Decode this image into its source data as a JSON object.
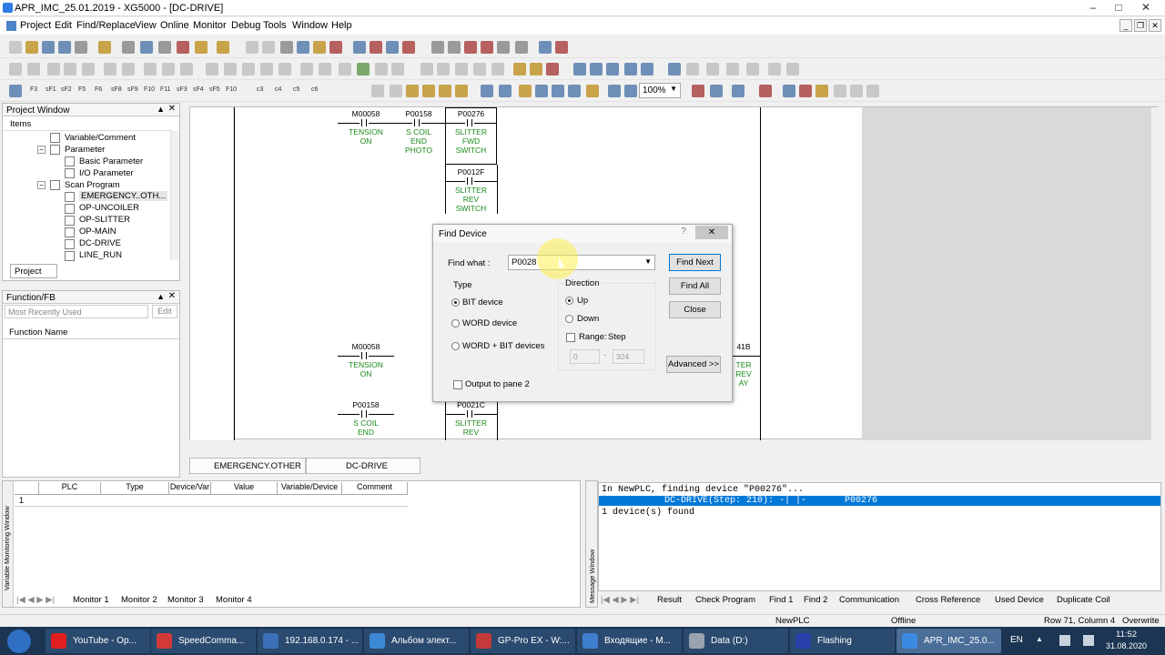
{
  "window": {
    "title": "APR_IMC_25.01.2019 - XG5000 - [DC-DRIVE]"
  },
  "menu": [
    "Project",
    "Edit",
    "Find/Replace",
    "View",
    "Online",
    "Monitor",
    "Debug",
    "Tools",
    "Window",
    "Help"
  ],
  "toolbar": {
    "zoom": "100%",
    "fkeys": [
      "F3",
      "sF1",
      "sF2",
      "F5",
      "F6",
      "sF8",
      "sF9",
      "F10",
      "F11",
      "sF3",
      "sF4",
      "sF5",
      "F10",
      "c3",
      "c4",
      "c5",
      "c6"
    ]
  },
  "project_window": {
    "title": "Project Window",
    "header": "Items",
    "items": [
      {
        "label": "Variable/Comment"
      },
      {
        "label": "Parameter"
      },
      {
        "label": "Basic Parameter"
      },
      {
        "label": "I/O Parameter"
      },
      {
        "label": "Scan Program"
      },
      {
        "label": "EMERGENCY..OTH..."
      },
      {
        "label": "OP-UNCOILER"
      },
      {
        "label": "OP-SLITTER"
      },
      {
        "label": "OP-MAIN"
      },
      {
        "label": "DC-DRIVE"
      },
      {
        "label": "LINE_RUN"
      }
    ],
    "tab": "Project"
  },
  "function_fb": {
    "title": "Function/FB",
    "recent": "Most Recently Used",
    "edit": "Edit",
    "column": "Function Name"
  },
  "ladder": {
    "top": [
      {
        "dev": "M00058",
        "cmt": [
          "TENSION",
          "ON"
        ]
      },
      {
        "dev": "P00158",
        "cmt": [
          "S COIL",
          "END",
          "PHOTO"
        ]
      },
      {
        "dev": "P00276",
        "cmt": [
          "SLITTER",
          "FWD",
          "SWITCH"
        ]
      },
      {
        "dev": "P0012F",
        "cmt": [
          "SLITTER",
          "REV",
          "SWITCH"
        ]
      }
    ],
    "bottom": [
      {
        "dev": "M00058",
        "cmt": [
          "TENSION",
          "ON"
        ]
      },
      {
        "dev": "P00158",
        "cmt": [
          "S COIL",
          "END"
        ]
      },
      {
        "dev": "P0021C",
        "cmt": [
          "SLITTER",
          "REV"
        ]
      },
      {
        "dev": "41B",
        "cmt": [
          "TER",
          "REV",
          "AY"
        ]
      }
    ]
  },
  "find_dialog": {
    "title": "Find Device",
    "find_what_label": "Find what :",
    "find_what_value": "P0028",
    "find_next": "Find Next",
    "find_all": "Find All",
    "close": "Close",
    "advanced": "Advanced >>",
    "type_label": "Type",
    "types": [
      "BIT device",
      "WORD device",
      "WORD + BIT devices"
    ],
    "direction_label": "Direction",
    "up": "Up",
    "down": "Down",
    "range_label": "Range:",
    "step_label": "Step",
    "range_from": "0",
    "range_to": "324",
    "output_pane2": "Output to pane 2"
  },
  "doc_tabs": [
    "EMERGENCY.OTHER",
    "DC-DRIVE"
  ],
  "var_monitor": {
    "side_label": "Variable Monitoring Window",
    "columns": [
      "PLC",
      "Type",
      "Device/Var",
      "Value",
      "Variable/Device",
      "Comment"
    ],
    "row1": "1",
    "tabs": [
      "Monitor 1",
      "Monitor 2",
      "Monitor 3",
      "Monitor 4"
    ]
  },
  "message": {
    "side_label": "Message Window",
    "lines": [
      "In NewPLC, finding device \"P00276\"...",
      "            DC-DRIVE(Step: 210): -| |-       P00276",
      "1 device(s) found"
    ],
    "tabs": [
      "Result",
      "Check Program",
      "Find 1",
      "Find 2",
      "Communication",
      "Cross Reference",
      "Used Device",
      "Duplicate Coil"
    ]
  },
  "status": {
    "plc": "NewPLC",
    "mode": "Offline",
    "pos": "Row 71, Column 4",
    "ovr": "Overwrite"
  },
  "taskbar": {
    "tasks": [
      "YouTube - Op...",
      "SpeedComma...",
      "192.168.0.174 - ...",
      "Альбом элект...",
      "GP-Pro EX - W:...",
      "Входящие - M...",
      "Data (D:)",
      "Flashing",
      "APR_IMC_25.0..."
    ],
    "lang": "EN",
    "time": "11:52",
    "date": "31.08.2020"
  },
  "colors": {
    "accent": "#0a64d8",
    "comment_green": "#1a8a1a",
    "selection": "#0078d7"
  }
}
